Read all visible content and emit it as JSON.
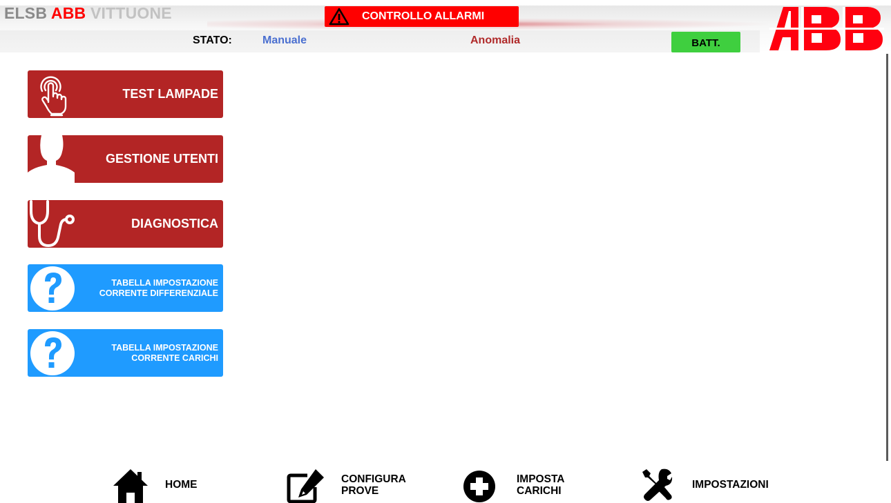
{
  "header": {
    "title_part1": "ELSB",
    "title_part2": "ABB",
    "title_part3": "VITTUONE",
    "alarm_button": "CONTROLLO ALLARMI",
    "stato_label": "STATO:",
    "stato_value": "Manuale",
    "anomalia": "Anomalia",
    "batt_button": "BATT.",
    "logo": "ABB"
  },
  "menu": {
    "test_lampade": "TEST LAMPADE",
    "gestione_utenti": "GESTIONE UTENTI",
    "diagnostica": "DIAGNOSTICA",
    "tab_diff_line1": "TABELLA IMPOSTAZIONE",
    "tab_diff_line2": "CORRENTE DIFFERENZIALE",
    "tab_car_line1": "TABELLA IMPOSTAZIONE",
    "tab_car_line2": "CORRENTE CARICHI"
  },
  "nav": {
    "home": "HOME",
    "configura_1": "CONFIGURA",
    "configura_2": "PROVE",
    "imposta_1": "IMPOSTA",
    "imposta_2": "CARICHI",
    "impostazioni": "IMPOSTAZIONI"
  },
  "colors": {
    "brand_red": "#ff0000",
    "menu_red": "#b32525",
    "menu_blue": "#1f9bff",
    "batt_green": "#3fcf3f",
    "stato_blue": "#4a6fd0"
  },
  "icons": {
    "alarm": "warning-icon",
    "test_lampade": "touch-hand-icon",
    "gestione_utenti": "user-icon",
    "diagnostica": "stethoscope-icon",
    "help": "question-icon",
    "home": "home-icon",
    "configura": "edit-icon",
    "imposta": "plus-circle-icon",
    "impostazioni": "tools-icon"
  }
}
